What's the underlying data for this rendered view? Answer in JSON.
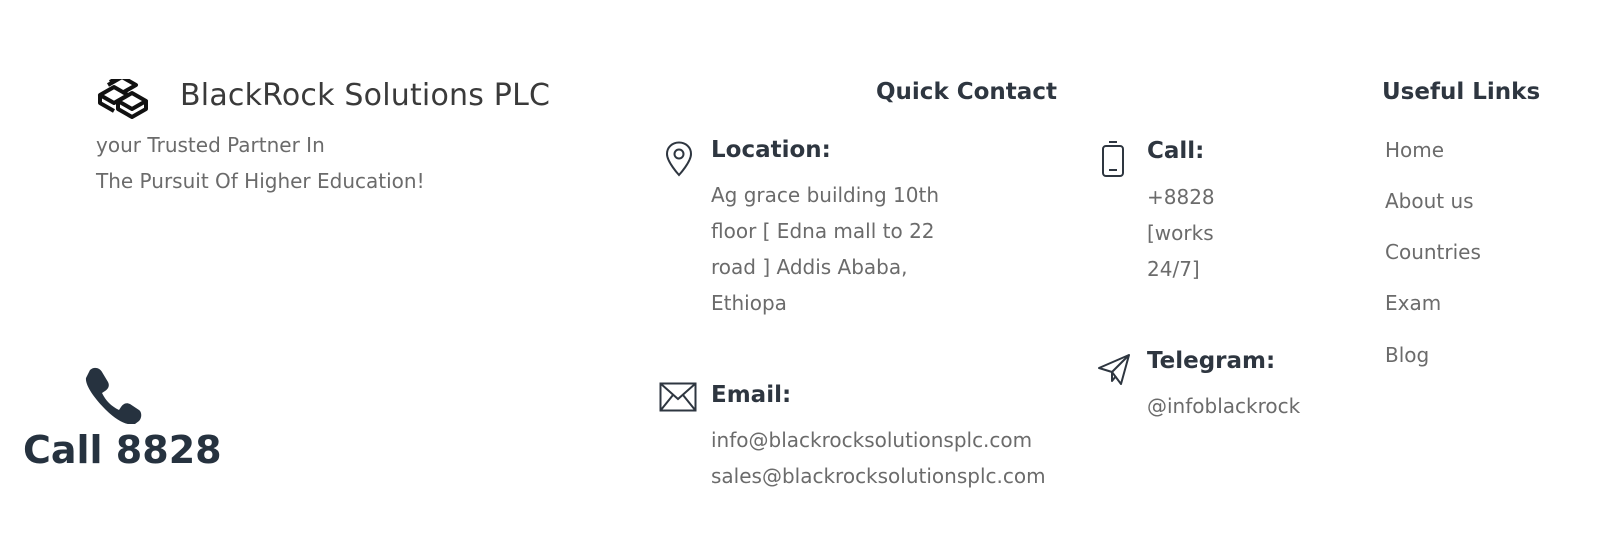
{
  "brand": {
    "name": "BlackRock Solutions PLC",
    "tagline_line1": "your Trusted Partner In",
    "tagline_line2": "The Pursuit Of Higher Education!"
  },
  "call_widget": {
    "label": "Call 8828",
    "icon": "phone-icon"
  },
  "quick_contact": {
    "heading": "Quick Contact",
    "location": {
      "icon": "location-pin-icon",
      "label": "Location:",
      "lines": [
        "Ag grace building 10th",
        "floor [ Edna mall to 22",
        "road ] Addis Ababa,",
        "Ethiopa"
      ]
    },
    "email": {
      "icon": "envelope-icon",
      "label": "Email:",
      "lines": [
        "info@blackrocksolutionsplc.com",
        "sales@blackrocksolutionsplc.com"
      ]
    },
    "call": {
      "icon": "mobile-phone-icon",
      "label": "Call:",
      "lines": [
        "+8828",
        "[works",
        "24/7]"
      ]
    },
    "telegram": {
      "icon": "paper-plane-icon",
      "label": "Telegram:",
      "lines": [
        "@infoblackrock"
      ]
    }
  },
  "useful_links": {
    "heading": "Useful Links",
    "items": [
      {
        "label": "Home"
      },
      {
        "label": "About us"
      },
      {
        "label": "Countries"
      },
      {
        "label": "Exam"
      },
      {
        "label": "Blog"
      }
    ]
  },
  "colors": {
    "heading": "#2e3640",
    "body_text": "#6b6b6b",
    "call_widget": "#26323f"
  }
}
